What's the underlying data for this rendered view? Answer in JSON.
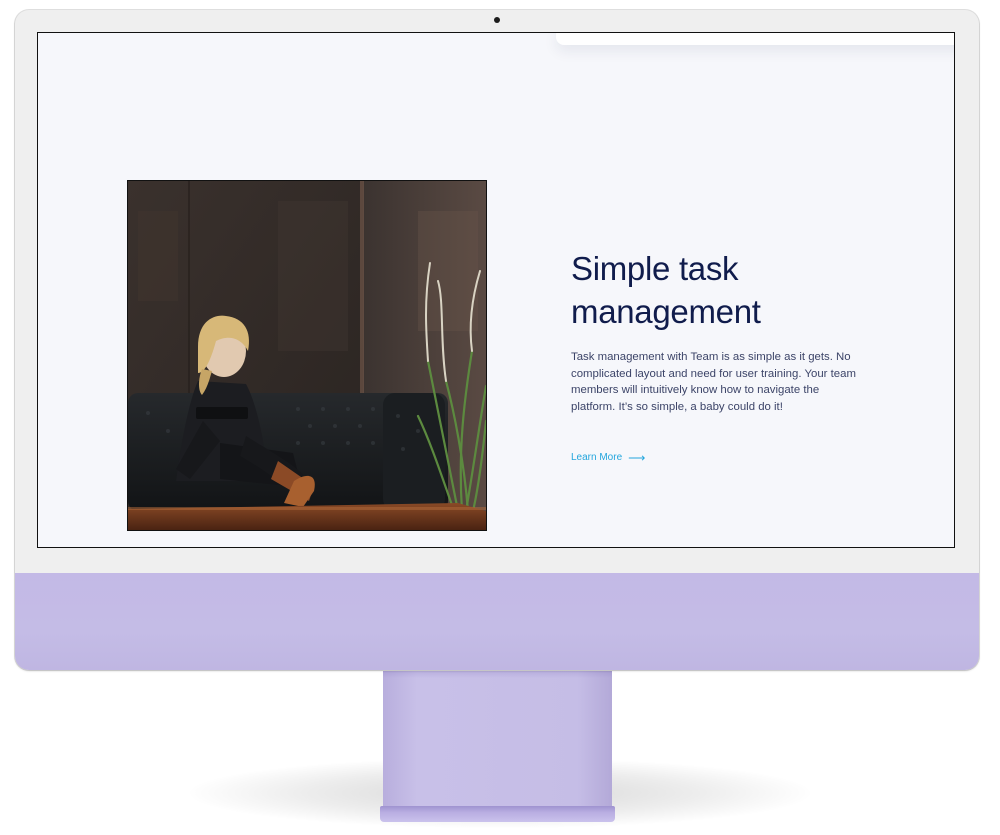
{
  "hero": {
    "headline_line1": "Simple task",
    "headline_line2": "management",
    "body": "Task management with Team is as simple as it gets. No complicated layout and need for user training. Your team members will intuitively know how to navigate the platform. It’s so simple, a baby could do it!",
    "cta_label": "Learn More",
    "cta_icon": "arrow-right-icon"
  },
  "colors": {
    "headline": "#101c4c",
    "body_text": "#3c4468",
    "link": "#24a6dd",
    "screen_background": "#f6f7fb",
    "monitor_chin": "#c3b9e6"
  }
}
